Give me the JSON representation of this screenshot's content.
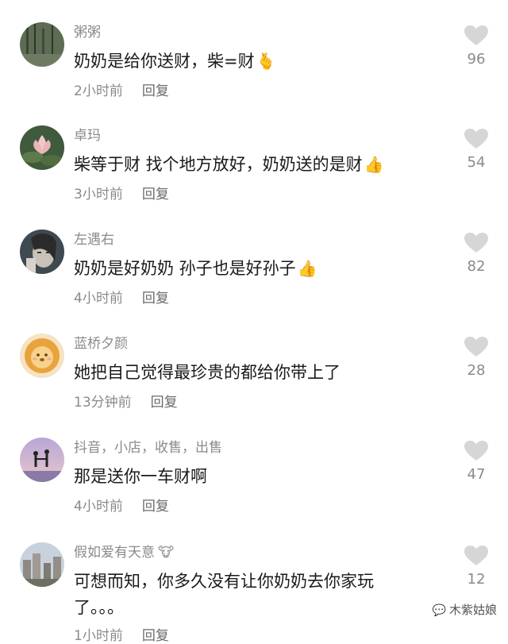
{
  "comments": [
    {
      "username": "粥粥",
      "username_emoji": "",
      "text": "奶奶是给你送财，柴=财",
      "text_emoji": "🫰",
      "time": "2小时前",
      "reply": "回复",
      "likes": "96",
      "avatar": "trees-avatar"
    },
    {
      "username": "卓玛",
      "username_emoji": "",
      "text": "柴等于财  找个地方放好，奶奶送的是财",
      "text_emoji": "👍",
      "time": "3小时前",
      "reply": "回复",
      "likes": "54",
      "avatar": "lotus-avatar"
    },
    {
      "username": "左遇右",
      "username_emoji": "",
      "text": "奶奶是好奶奶 孙子也是好孙子",
      "text_emoji": "👍",
      "time": "4小时前",
      "reply": "回复",
      "likes": "82",
      "avatar": "portrait-avatar"
    },
    {
      "username": "蓝桥夕颜",
      "username_emoji": "",
      "text": "她把自己觉得最珍贵的都给你带上了",
      "text_emoji": "",
      "time": "13分钟前",
      "reply": "回复",
      "likes": "28",
      "avatar": "lion-avatar"
    },
    {
      "username": "抖音，小店，收售，出售",
      "username_emoji": "",
      "text": "那是送你一车财啊",
      "text_emoji": "",
      "time": "4小时前",
      "reply": "回复",
      "likes": "47",
      "avatar": "couple-avatar"
    },
    {
      "username": "假如爱有天意",
      "username_emoji": "🐮",
      "text": "可想而知，你多久没有让你奶奶去你家玩了。。。",
      "text_emoji": "",
      "time": "1小时前",
      "reply": "回复",
      "likes": "12",
      "avatar": "city-avatar"
    }
  ],
  "watermark": {
    "text": "木紫姑娘",
    "icon": "wechat-icon"
  }
}
